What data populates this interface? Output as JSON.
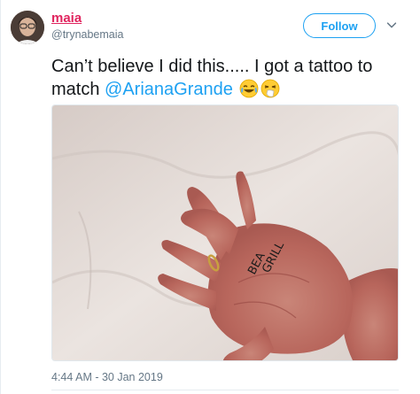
{
  "tweet": {
    "display_name": "maia",
    "handle": "@trynabemaia",
    "follow_label": "Follow",
    "text_before": "Can’t believe I did this..... I got a tattoo to match ",
    "mention": "@ArianaGrande",
    "emojis": [
      "face-with-tears-of-joy-icon",
      "sneezing-face-icon"
    ],
    "timestamp": "4:44 AM - 30 Jan 2019",
    "image_text": [
      "BEA",
      "GRILL"
    ]
  },
  "colors": {
    "name": "#e0245e",
    "accent": "#1da1f2",
    "secondary_text": "#657786"
  }
}
